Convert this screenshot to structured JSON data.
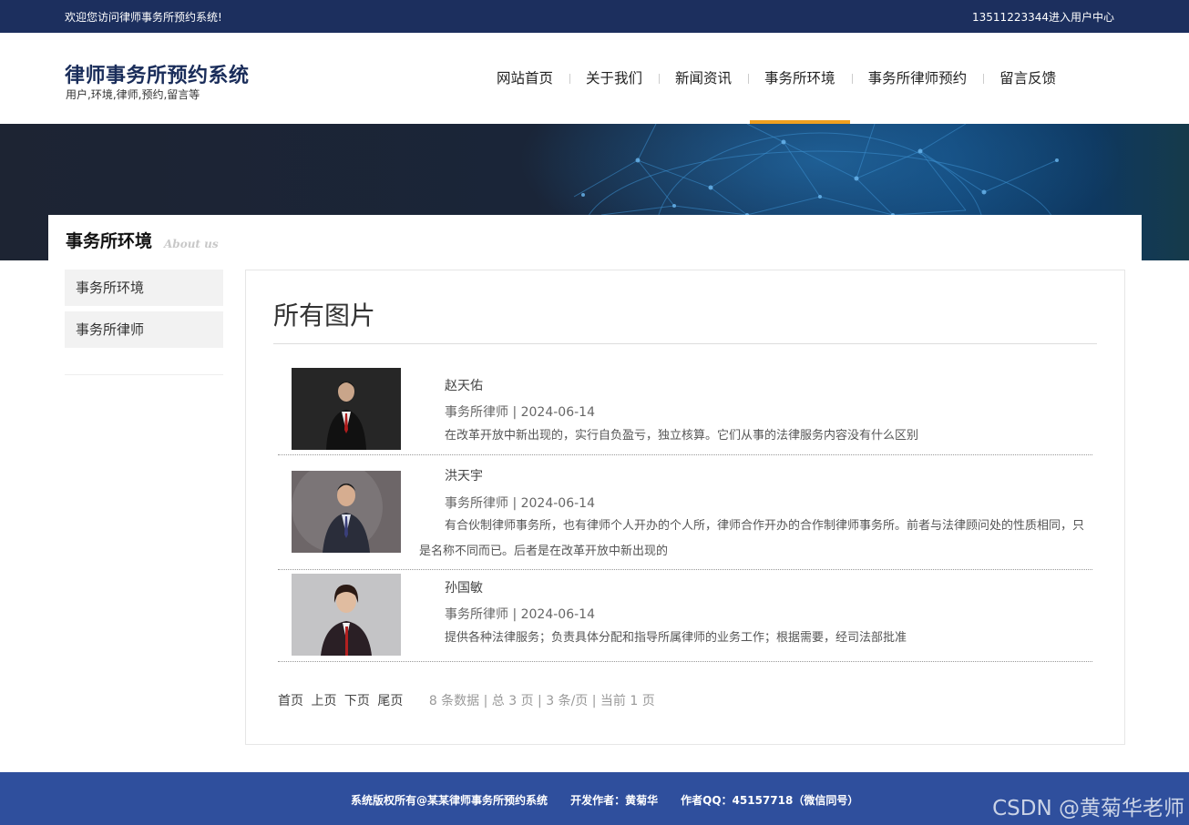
{
  "topbar": {
    "welcome": "欢迎您访问律师事务所预约系统!",
    "user_link": "13511223344进入用户中心"
  },
  "header": {
    "title": "律师事务所预约系统",
    "subtitle": "用户,环境,律师,预约,留言等"
  },
  "nav": [
    {
      "label": "网站首页"
    },
    {
      "label": "关于我们"
    },
    {
      "label": "新闻资讯"
    },
    {
      "label": "事务所环境",
      "active": true
    },
    {
      "label": "事务所律师预约"
    },
    {
      "label": "留言反馈"
    }
  ],
  "page_title": {
    "title": "事务所环境",
    "english": "About us"
  },
  "sidebar": [
    {
      "label": "事务所环境"
    },
    {
      "label": "事务所律师"
    }
  ],
  "content": {
    "heading": "所有图片",
    "entries": [
      {
        "name": "赵天佑",
        "meta": "事务所律师 | 2024-06-14",
        "desc": "在改革开放中新出现的，实行自负盈亏，独立核算。它们从事的法律服务内容没有什么区别"
      },
      {
        "name": "洪天宇",
        "meta": "事务所律师 | 2024-06-14",
        "desc": "有合伙制律师事务所，也有律师个人开办的个人所，律师合作开办的合作制律师事务所。前者与法律顾问处的性质相同，只是名称不同而已。后者是在改革开放中新出现的"
      },
      {
        "name": "孙国敏",
        "meta": "事务所律师 | 2024-06-14",
        "desc": "提供各种法律服务；负责具体分配和指导所属律师的业务工作；根据需要，经司法部批准"
      }
    ]
  },
  "pager": {
    "first": "首页",
    "prev": "上页",
    "next": "下页",
    "last": "尾页",
    "info": "8 条数据 | 总 3 页 | 3 条/页 | 当前 1 页"
  },
  "footer": {
    "text": "系统版权所有@某某律师事务所预约系统      开发作者：黄菊华      作者QQ：45157718（微信同号）",
    "watermark": "CSDN @黄菊华老师"
  },
  "colors": {
    "topbar": "#1c2f5e",
    "footer": "#2f4f9d",
    "nav_active": "#f0a020"
  }
}
